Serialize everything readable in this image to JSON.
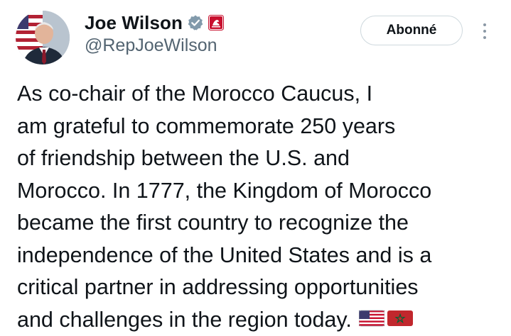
{
  "author": {
    "display_name": "Joe Wilson",
    "handle": "@RepJoeWilson",
    "verified_icon": "verified-check-icon",
    "affiliation_icon": "government-badge-icon"
  },
  "actions": {
    "follow_label": "Abonné",
    "more_icon": "more-options-icon"
  },
  "tweet": {
    "lines": [
      "As co-chair of the Morocco Caucus, I",
      "am grateful to commemorate 250 years",
      "of friendship between the U.S. and",
      "Morocco. In 1777, the Kingdom of Morocco",
      "became the first country to recognize the",
      "independence of the United States and is a",
      "critical partner in addressing opportunities",
      "and challenges in the region today."
    ],
    "emoji": [
      "flag-united-states-icon",
      "flag-morocco-icon"
    ]
  },
  "colors": {
    "text": "#0f1419",
    "secondary": "#536471",
    "verified_grey": "#829aab",
    "gov_badge_red": "#c8102e",
    "button_border": "#cfd9de"
  }
}
